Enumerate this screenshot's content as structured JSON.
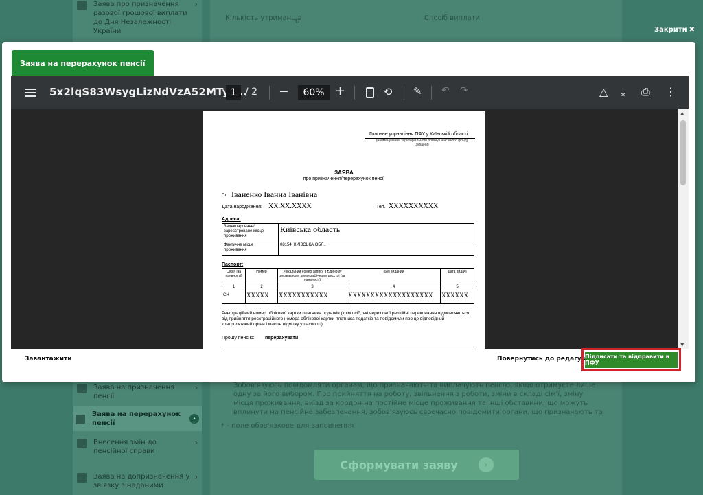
{
  "background": {
    "sidebar_items": [
      {
        "label": "Заява про призначення разової грошової виплати до Дня Незалежності України"
      },
      {
        "label": "Заява на призначення пенсії"
      },
      {
        "label": "Заява на перерахунок пенсії"
      },
      {
        "label": "Внесення змін до пенсійної справи"
      },
      {
        "label": "Заява на допризначення у зв'язку з наданими"
      }
    ],
    "field_count_label": "Кількість утриманців",
    "field_count_value": "0",
    "field_method_label": "Спосіб виплати",
    "consent_text": "Зобов'язуюсь повідомляти органам, що призначають та виплачують пенсію, якщо отримуєте лише одну за його вибором. Про прийняття на роботу, звільнення з роботи, зміни в складі сім'ї, зміну місця проживання, виїзд за кордон на постійне місце проживання та інші обставини, що можуть вплинути на пенсійне забезпечення, зобов'язуюсь своєчасно повідомити органи, що призначають та виплачують пенсію*",
    "required_note": "* - поле обов'язкове для заповнення",
    "form_button": "Сформувати заяву"
  },
  "close_link": "Закрити",
  "modal": {
    "tab_label": "Заява на перерахунок пенсії",
    "viewer": {
      "file_name": "5x2lqS83WsygLizNdVzA52MTyz...",
      "current_page": "1",
      "total_pages": "/ 2",
      "zoom": "60%"
    },
    "download_link": "Завантажити",
    "back_link": "Повернутись до редагування",
    "sign_button": "Підписати та відправити в ПФУ",
    "sign_button_color": "#2f8a2a",
    "highlight_color": "#d3232a"
  },
  "pdf": {
    "org_name": "Головне управління ПФУ у Київській області",
    "org_sub": "(найменування територіального органу Пенсійного фонду України)",
    "title": "ЗАЯВА",
    "subtitle": "про призначення/перерахунок пенсії",
    "gr_label": "Гр.",
    "full_name": "Іваненко Іванна Іванівна",
    "dob_label": "Дата народження:",
    "dob_value": "XX.XX.XXXX",
    "tel_label": "Тел.",
    "tel_value": "XXXXXXXXXX",
    "address_label": "Адреса:",
    "address_rows": [
      {
        "label": "Задекларoване/ зареєстроване місце проживання",
        "value": "Київська область"
      },
      {
        "label": "Фактичне місце проживання",
        "value": "08154, КИЇВСЬКА ОБЛ.,"
      }
    ],
    "passport_label": "Паспорт:",
    "passport_headers": [
      "Серія (за наявності)",
      "Номер",
      "Унікальний номер запису в Єдиному державному демографічному реєстрі (за наявності)",
      "Ким виданий",
      "Дата видачі"
    ],
    "passport_numbers": [
      "1",
      "2",
      "3",
      "4",
      "5"
    ],
    "passport_values": [
      "СН",
      "XXXXX",
      "XXXXXXXXXXX",
      "XXXXXXXXXXXXXXXXXXX",
      "XXXXXX"
    ],
    "tax_paragraph": "Реєстраційний номер облікової картки платника податків (крім осіб, які через свої релігійні переконання відмовляються від прийняття реєстраційного номера облікової картки платника податків та повідомили про це відповідний контролюючий орган і мають відмітку у паспорті)",
    "ask_label": "Прошу пенсію:",
    "ask_value": "перерахувати"
  }
}
